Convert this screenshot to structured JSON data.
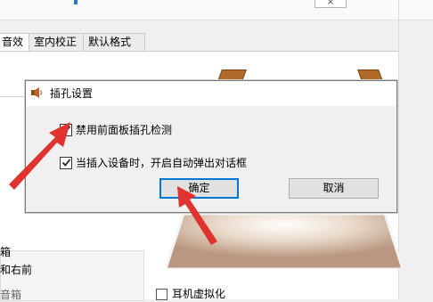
{
  "background_window": {
    "close_glyph": "×",
    "tabs": [
      {
        "label": "音效"
      },
      {
        "label": "室内校正"
      },
      {
        "label": "默认格式"
      }
    ],
    "left_labels": [
      "箱",
      "和右前",
      "音箱"
    ],
    "virtualization_label": "耳机虚拟化"
  },
  "dialog": {
    "title": "插孔设置",
    "icon": "speaker-icon",
    "checkboxes": [
      {
        "label": "禁用前面板插孔检测",
        "checked": true
      },
      {
        "label": "当插入设备时，开启自动弹出对话框",
        "checked": true
      }
    ],
    "ok_label": "确定",
    "cancel_label": "取消"
  },
  "annotation": {
    "arrow_color": "#e0322e"
  }
}
